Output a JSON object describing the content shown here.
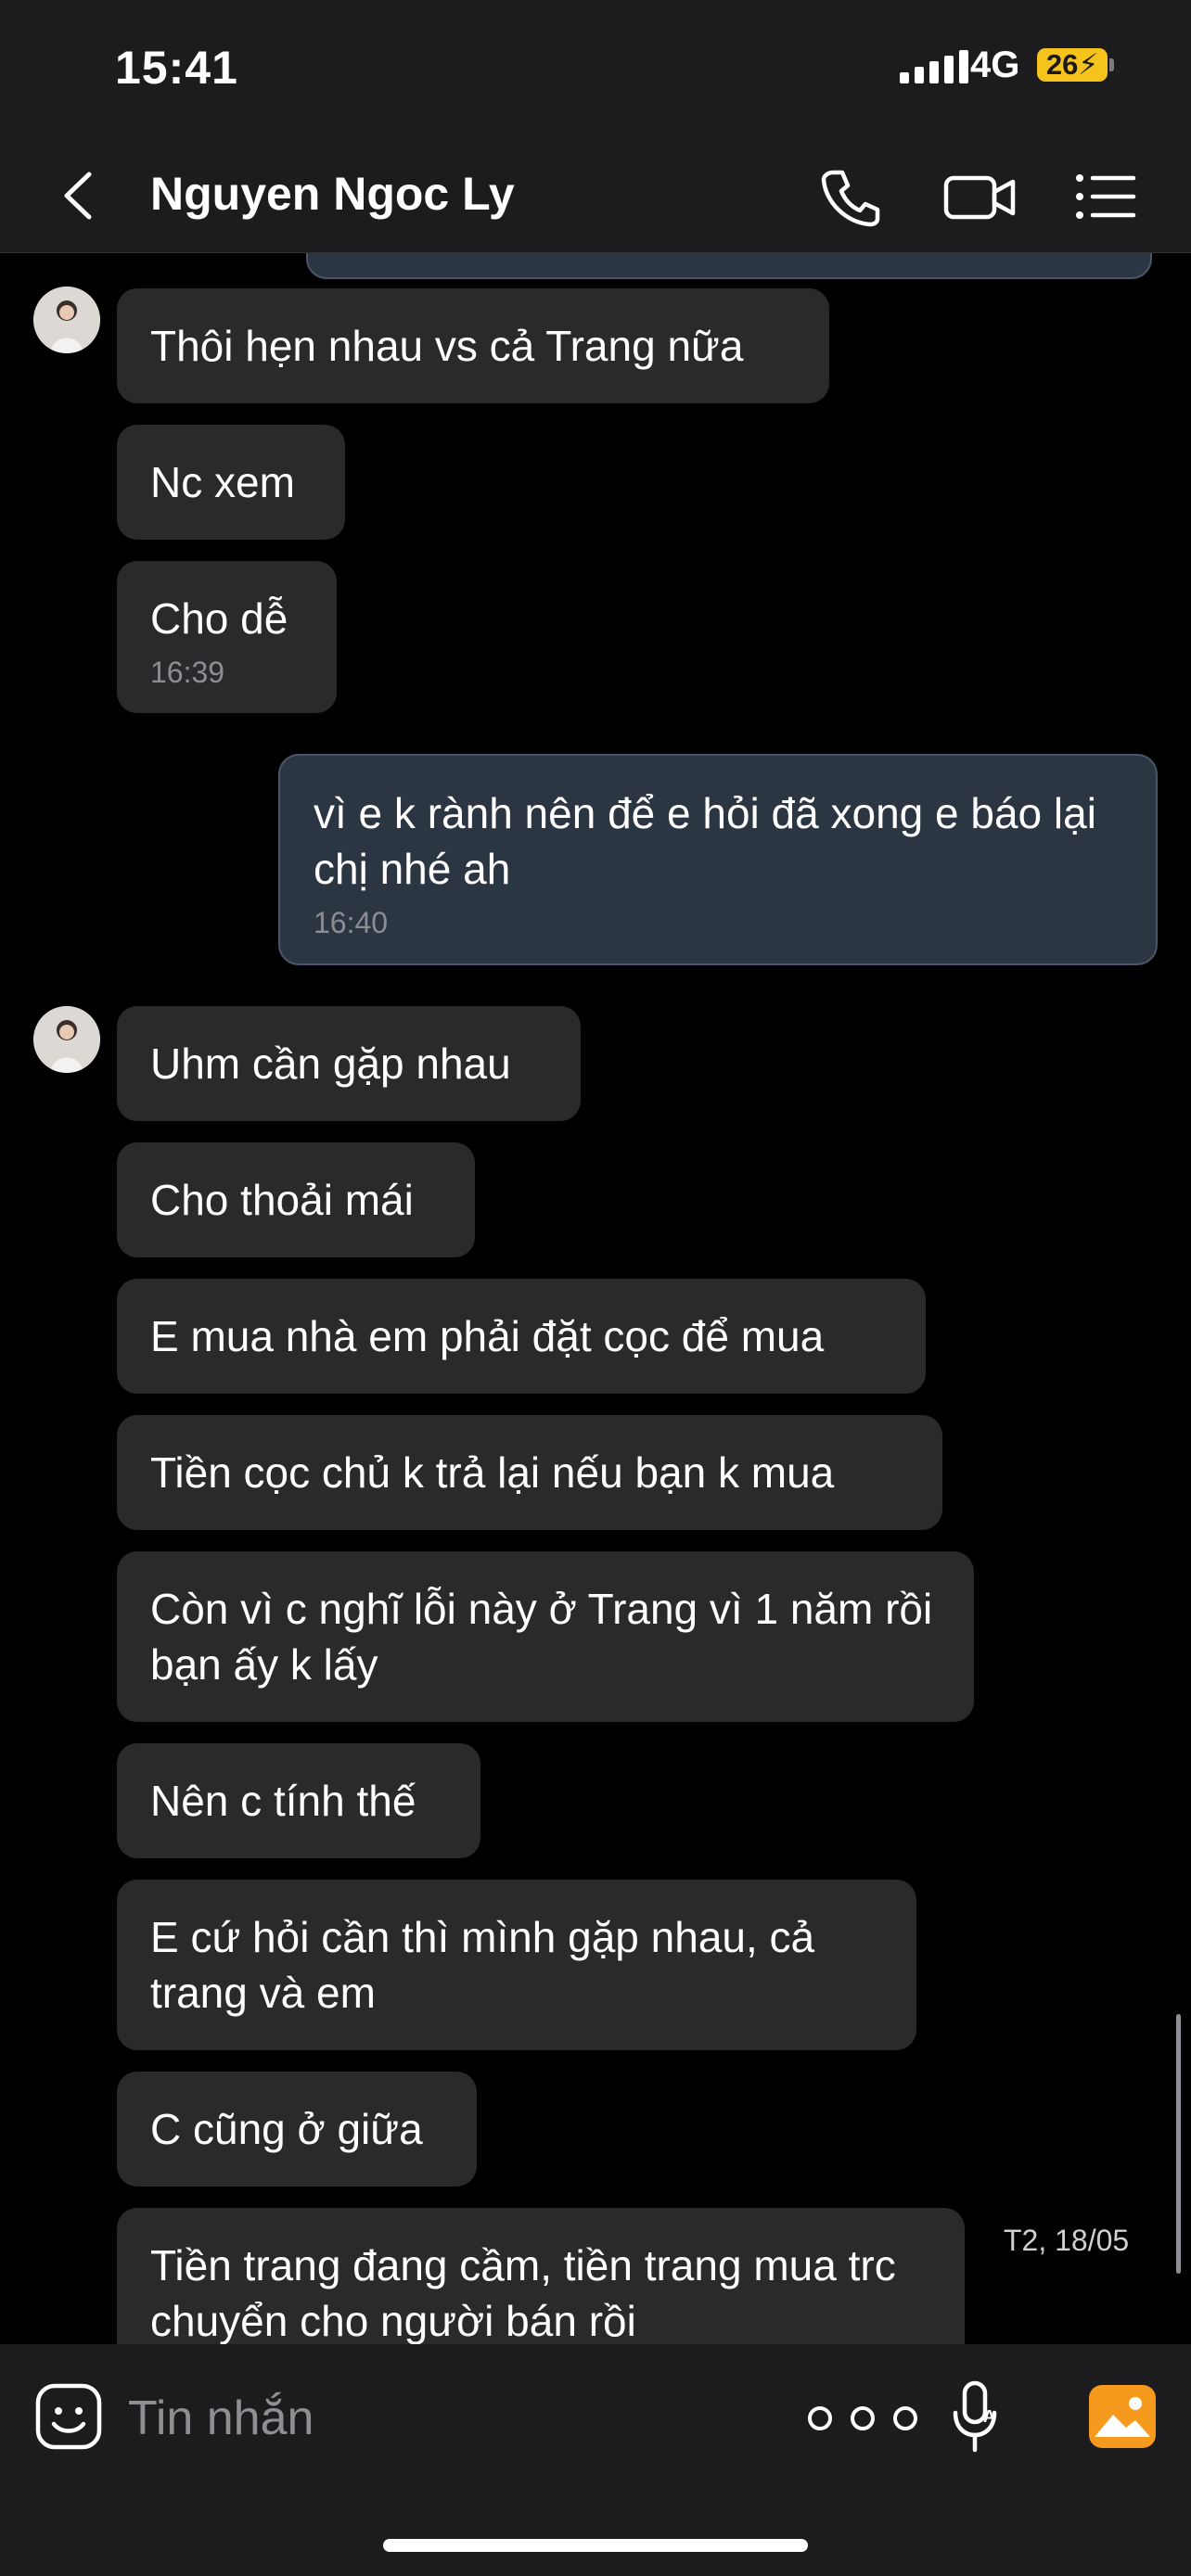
{
  "status_bar": {
    "time": "15:41",
    "network": "4G",
    "battery": "26"
  },
  "header": {
    "contact_name": "Nguyen Ngoc Ly"
  },
  "messages": [
    {
      "direction": "in",
      "text": "Thôi hẹn nhau vs cả Trang nữa"
    },
    {
      "direction": "in",
      "text": "Nc xem"
    },
    {
      "direction": "in",
      "text": "Cho dễ",
      "time": "16:39"
    },
    {
      "direction": "out",
      "text": "vì e k rành nên để e hỏi đã xong e báo lại chị nhé ah",
      "time": "16:40"
    },
    {
      "direction": "in",
      "text": "Uhm cần gặp nhau"
    },
    {
      "direction": "in",
      "text": "Cho thoải mái"
    },
    {
      "direction": "in",
      "text": "E mua nhà em phải đặt cọc để mua"
    },
    {
      "direction": "in",
      "text": "Tiền cọc chủ k trả lại nếu bạn k mua"
    },
    {
      "direction": "in",
      "text": "Còn vì c nghĩ lỗi này ở Trang vì 1 năm rồi bạn ấy k lấy"
    },
    {
      "direction": "in",
      "text": "Nên c tính thế"
    },
    {
      "direction": "in",
      "text": "E cứ hỏi cần thì mình gặp nhau, cả trang và em"
    },
    {
      "direction": "in",
      "text": "C cũng ở giữa"
    },
    {
      "direction": "in",
      "text": "Tiền trang đang cầm, tiền trang mua trc chuyển cho người bán rồi"
    }
  ],
  "date_label": "T2, 18/05",
  "composer": {
    "placeholder": "Tin nhắn"
  },
  "colors": {
    "bubble_in": "#2a2a2c",
    "bubble_out": "#2c3542",
    "accent": "#f59a1c"
  }
}
